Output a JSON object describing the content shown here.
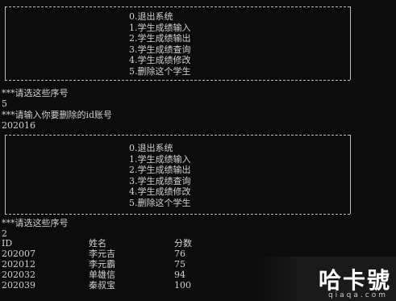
{
  "menu": [
    "0.退出系统",
    "1.学生成绩输入",
    "2.学生成绩输出",
    "3.学生成绩查询",
    "4.学生成绩修改",
    "5.删除这个学生"
  ],
  "console": {
    "prompt_select": "***请选这些序号",
    "input_1": "5",
    "prompt_id": "***请输入你要删除的id账号",
    "input_id": "202016",
    "prompt_select_2": "***请选这些序号",
    "input_2": "2"
  },
  "table": {
    "headers": [
      "ID",
      "姓名",
      "分数"
    ],
    "rows": [
      [
        "202007",
        "李元吉",
        "76"
      ],
      [
        "202012",
        "李元霸",
        "75"
      ],
      [
        "202032",
        "单雄信",
        "94"
      ],
      [
        "202039",
        "秦叔宝",
        "100"
      ]
    ]
  },
  "watermark": {
    "text": "哈卡號",
    "sub": "qiaqa.com"
  }
}
